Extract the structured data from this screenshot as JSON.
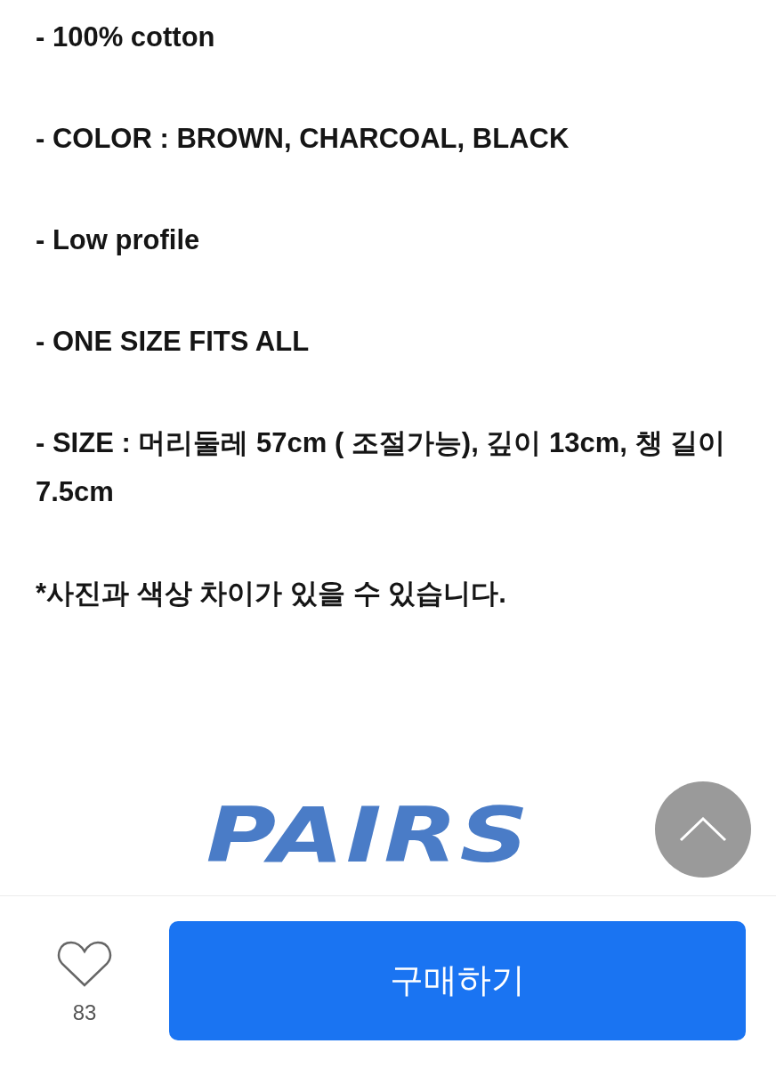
{
  "description": [
    "- 100% cotton",
    "- COLOR : BROWN, CHARCOAL, BLACK",
    "- Low profile",
    "- ONE SIZE FITS ALL",
    "- SIZE : 머리둘레 57cm ( 조절가능), 깊이 13cm, 챙 길이 7.5cm",
    "*사진과 색상 차이가 있을 수 있습니다."
  ],
  "logo": "PAIRS",
  "bottom_bar": {
    "like": {
      "liked": false,
      "count": "83"
    },
    "buy_button": "구매하기"
  }
}
